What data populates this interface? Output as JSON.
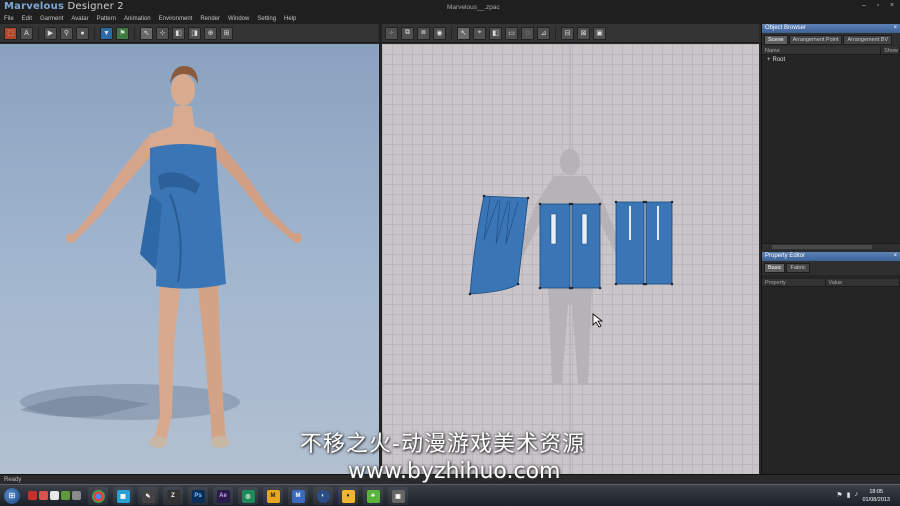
{
  "app": {
    "logo_main": "Marvelous",
    "logo_sub": " Designer 2",
    "window_title": "Marvelous__.zpac",
    "controls": [
      "–",
      "▫",
      "×"
    ]
  },
  "menu": [
    "File",
    "Edit",
    "Garment",
    "Avatar",
    "Pattern",
    "Animation",
    "Environment",
    "Render",
    "Window",
    "Setting",
    "Help"
  ],
  "object_browser": {
    "title": "Object Browser",
    "tabs": [
      "Scene",
      "Arrangement Point",
      "Arrangement BV"
    ],
    "columns": [
      "Name",
      "Show"
    ],
    "root": "Root"
  },
  "property_editor": {
    "title": "Property Editor",
    "tabs": [
      "Basic",
      "Fabric"
    ],
    "columns": [
      "Property",
      "Value"
    ]
  },
  "status": "Ready",
  "taskbar": {
    "time": "18:05",
    "date": "01/08/2013"
  },
  "watermark": {
    "line1": "不移之火-动漫游戏美术资源",
    "line2": "www.byzhihuo.com"
  },
  "colors": {
    "fabric": "#3a75b5",
    "panel_title": "#4a6fa5"
  }
}
